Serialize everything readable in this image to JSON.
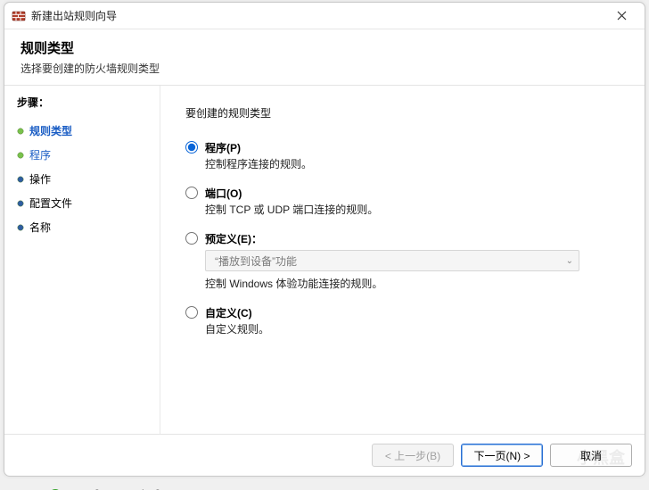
{
  "window": {
    "title": "新建出站规则向导"
  },
  "header": {
    "title": "规则类型",
    "subtitle": "选择要创建的防火墙规则类型"
  },
  "sidebar": {
    "title": "步骤：",
    "items": [
      {
        "label": "规则类型",
        "state": "current"
      },
      {
        "label": "程序",
        "state": "link"
      },
      {
        "label": "操作",
        "state": "normal"
      },
      {
        "label": "配置文件",
        "state": "normal"
      },
      {
        "label": "名称",
        "state": "normal"
      }
    ]
  },
  "content": {
    "section_title": "要创建的规则类型",
    "options": [
      {
        "key": "program",
        "title": "程序(P)",
        "desc": "控制程序连接的规则。",
        "selected": true
      },
      {
        "key": "port",
        "title": "端口(O)",
        "desc": "控制 TCP 或 UDP 端口连接的规则。",
        "selected": false
      },
      {
        "key": "predefined",
        "title": "预定义(E)：",
        "desc": "控制 Windows 体验功能连接的规则。",
        "selected": false,
        "dropdown_value": "“播放到设备”功能"
      },
      {
        "key": "custom",
        "title": "自定义(C)",
        "desc": "自定义规则。",
        "selected": false
      }
    ]
  },
  "footer": {
    "back": "< 上一步(B)",
    "next": "下一页(N) >",
    "cancel": "取消"
  },
  "background_item": "SunloginDesktopAgent"
}
